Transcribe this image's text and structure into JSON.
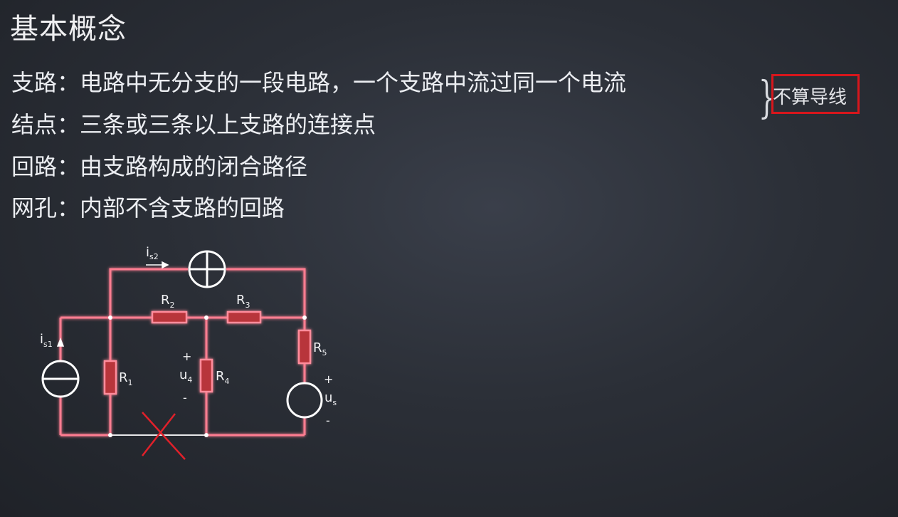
{
  "title": "基本概念",
  "definitions": [
    {
      "term": "支路：",
      "text": "电路中无分支的一段电路，一个支路中流过同一个电流"
    },
    {
      "term": "结点：",
      "text": "三条或三条以上支路的连接点"
    },
    {
      "term": "回路：",
      "text": "由支路构成的闭合路径"
    },
    {
      "term": "网孔：",
      "text": "内部不含支路的回路"
    }
  ],
  "brace": "}",
  "note": "不算导线",
  "circuit": {
    "labels": {
      "is2": {
        "main": "i",
        "sub": "s2"
      },
      "is1": {
        "main": "i",
        "sub": "s1"
      },
      "R1": {
        "main": "R",
        "sub": "1"
      },
      "R2": {
        "main": "R",
        "sub": "2"
      },
      "R3": {
        "main": "R",
        "sub": "3"
      },
      "R4": {
        "main": "R",
        "sub": "4"
      },
      "R5": {
        "main": "R",
        "sub": "5"
      },
      "u4": {
        "main": "u",
        "sub": "4",
        "plus": "+",
        "minus": "-"
      },
      "us": {
        "main": "u",
        "sub": "s",
        "plus": "+",
        "minus": "-"
      }
    },
    "colors": {
      "wire": "#ff8fa0",
      "wire_glow": "#ff3b58",
      "resistor": "#c0393f",
      "cross": "#e0202a",
      "plain_wire": "#e8e8ea"
    }
  }
}
